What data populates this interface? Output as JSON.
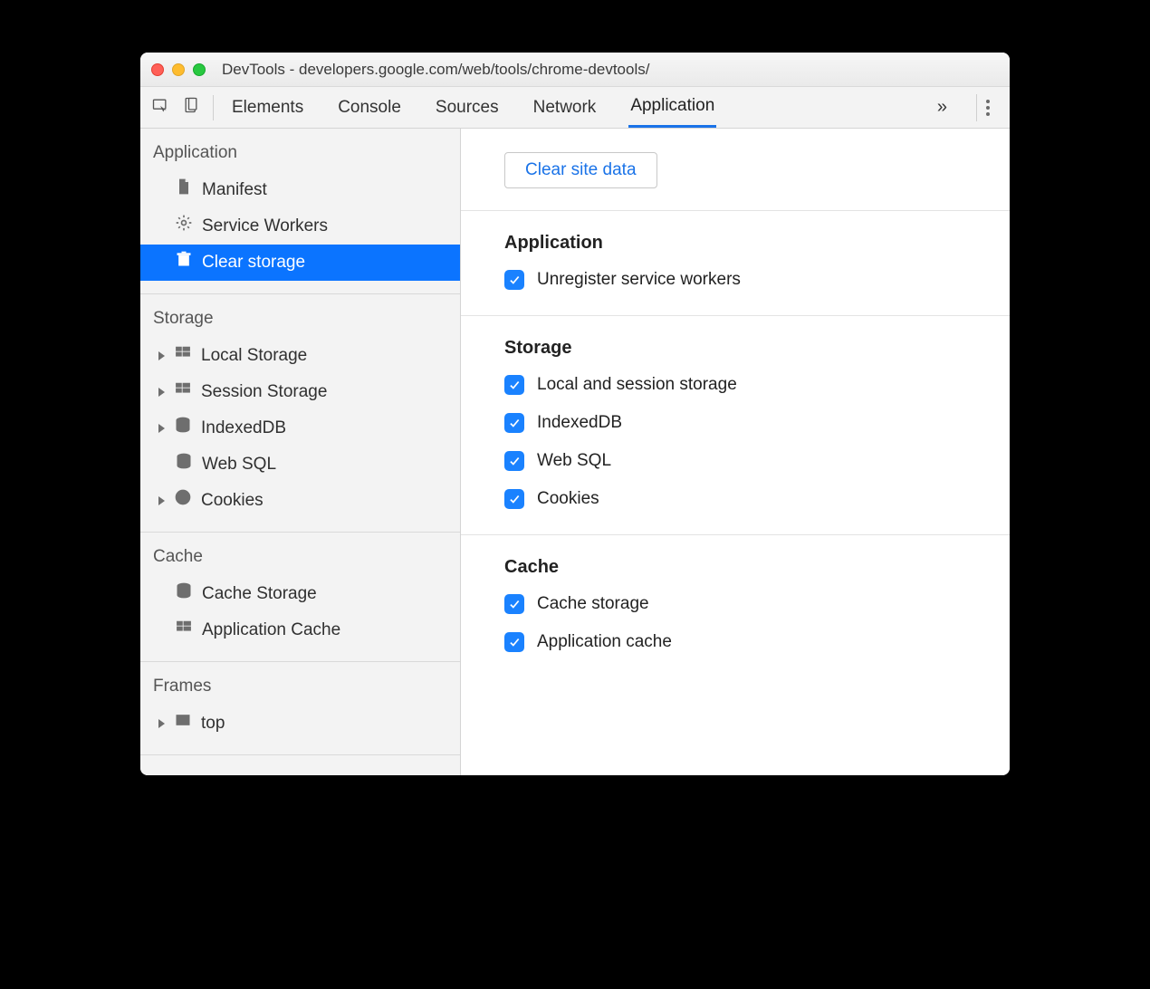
{
  "window": {
    "title": "DevTools - developers.google.com/web/tools/chrome-devtools/"
  },
  "toolbar": {
    "tabs": [
      "Elements",
      "Console",
      "Sources",
      "Network",
      "Application"
    ],
    "active_tab": "Application"
  },
  "sidebar": {
    "groups": [
      {
        "heading": "Application",
        "items": [
          {
            "label": "Manifest",
            "icon": "file",
            "selected": false,
            "expandable": false
          },
          {
            "label": "Service Workers",
            "icon": "gear",
            "selected": false,
            "expandable": false
          },
          {
            "label": "Clear storage",
            "icon": "trash",
            "selected": true,
            "expandable": false
          }
        ]
      },
      {
        "heading": "Storage",
        "items": [
          {
            "label": "Local Storage",
            "icon": "grid",
            "selected": false,
            "expandable": true
          },
          {
            "label": "Session Storage",
            "icon": "grid",
            "selected": false,
            "expandable": true
          },
          {
            "label": "IndexedDB",
            "icon": "db",
            "selected": false,
            "expandable": true
          },
          {
            "label": "Web SQL",
            "icon": "db",
            "selected": false,
            "expandable": false
          },
          {
            "label": "Cookies",
            "icon": "cookie",
            "selected": false,
            "expandable": true
          }
        ]
      },
      {
        "heading": "Cache",
        "items": [
          {
            "label": "Cache Storage",
            "icon": "db",
            "selected": false,
            "expandable": false
          },
          {
            "label": "Application Cache",
            "icon": "grid",
            "selected": false,
            "expandable": false
          }
        ]
      },
      {
        "heading": "Frames",
        "items": [
          {
            "label": "top",
            "icon": "frame",
            "selected": false,
            "expandable": true
          }
        ]
      }
    ]
  },
  "main": {
    "clear_button_label": "Clear site data",
    "sections": [
      {
        "heading": "Application",
        "checks": [
          {
            "label": "Unregister service workers",
            "checked": true
          }
        ]
      },
      {
        "heading": "Storage",
        "checks": [
          {
            "label": "Local and session storage",
            "checked": true
          },
          {
            "label": "IndexedDB",
            "checked": true
          },
          {
            "label": "Web SQL",
            "checked": true
          },
          {
            "label": "Cookies",
            "checked": true
          }
        ]
      },
      {
        "heading": "Cache",
        "checks": [
          {
            "label": "Cache storage",
            "checked": true
          },
          {
            "label": "Application cache",
            "checked": true
          }
        ]
      }
    ]
  },
  "colors": {
    "accent": "#1a73e8",
    "selection": "#0b74ff",
    "checkbox": "#1a82ff"
  }
}
